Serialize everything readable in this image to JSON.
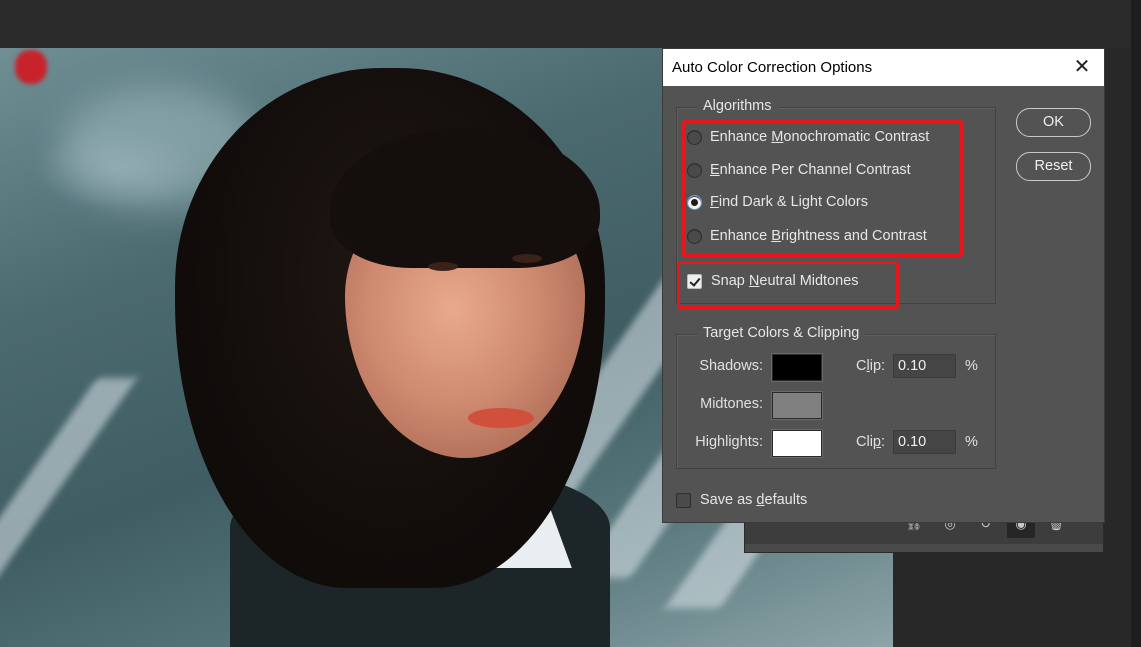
{
  "dialog": {
    "title": "Auto Color Correction Options",
    "ok_label": "OK",
    "reset_label": "Reset",
    "algorithms": {
      "legend": "Algorithms",
      "options": [
        {
          "pre": "Enhance ",
          "u": "M",
          "post": "onochromatic Contrast",
          "selected": false
        },
        {
          "pre": "",
          "u": "E",
          "post": "nhance Per Channel Contrast",
          "selected": false
        },
        {
          "pre": "",
          "u": "F",
          "post": "ind Dark & Light Colors",
          "selected": true
        },
        {
          "pre": "Enhance ",
          "u": "B",
          "post": "rightness and Contrast",
          "selected": false
        }
      ]
    },
    "snap_midtones": {
      "pre": "Snap ",
      "u": "N",
      "post": "eutral Midtones",
      "checked": true
    },
    "target": {
      "legend": "Target Colors & Clipping",
      "shadows": {
        "label": "Shadows:",
        "color": "#000000",
        "clip_pre": "C",
        "clip_u": "l",
        "clip_post": "ip:",
        "clip_value": "0.10",
        "unit": "%"
      },
      "midtones": {
        "label": "Midtones:",
        "color": "#808080"
      },
      "highlights": {
        "label": "Highlights:",
        "color": "#ffffff",
        "clip_pre": "Cli",
        "clip_u": "p",
        "clip_post": ":",
        "clip_value": "0.10",
        "unit": "%"
      }
    },
    "save_defaults": {
      "pre": "Save as ",
      "u": "d",
      "post": "efaults",
      "checked": false
    }
  },
  "colors": {
    "dialog_bg": "#535353",
    "highlight_annotation": "#e8161b"
  }
}
